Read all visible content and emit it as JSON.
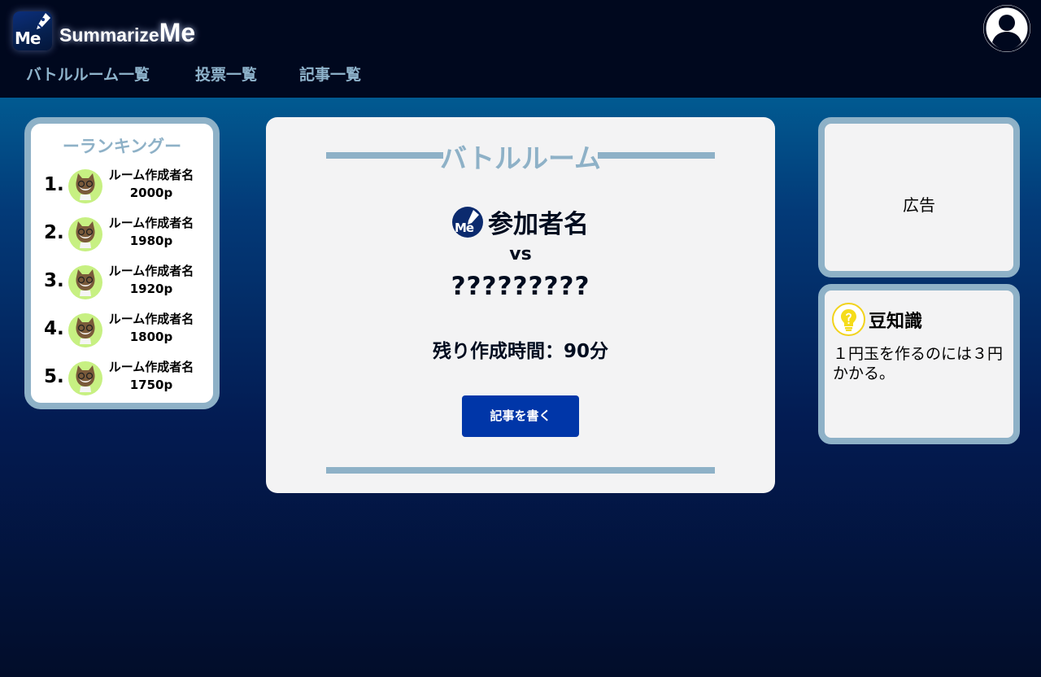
{
  "header": {
    "logo_text": "Me",
    "brand_part1": "Summarize",
    "brand_part2": "Me",
    "nav": [
      {
        "label": "バトルルーム一覧"
      },
      {
        "label": "投票一覧"
      },
      {
        "label": "記事一覧"
      }
    ]
  },
  "ranking": {
    "title": "ーランキングー",
    "items": [
      {
        "rank": "1.",
        "name": "ルーム作成者名",
        "points": "2000p"
      },
      {
        "rank": "2.",
        "name": "ルーム作成者名",
        "points": "1980p"
      },
      {
        "rank": "3.",
        "name": "ルーム作成者名",
        "points": "1920p"
      },
      {
        "rank": "4.",
        "name": "ルーム作成者名",
        "points": "1800p"
      },
      {
        "rank": "5.",
        "name": "ルーム作成者名",
        "points": "1750p"
      }
    ]
  },
  "battle": {
    "title": "バトルルーム",
    "participant_icon_text": "Me",
    "participant": "参加者名",
    "vs": "vs",
    "opponent": "?????????",
    "remaining": "残り作成時間：90分",
    "write_button": "記事を書く"
  },
  "sidebar": {
    "ad_label": "広告",
    "trivia_title": "豆知識",
    "trivia_text": "１円玉を作るのには３円かかる。"
  },
  "colors": {
    "header_bg": "#00081e",
    "accent_frame": "#8eb1c7",
    "primary_button": "#0036a8",
    "card_bg": "#f3f3f4"
  }
}
